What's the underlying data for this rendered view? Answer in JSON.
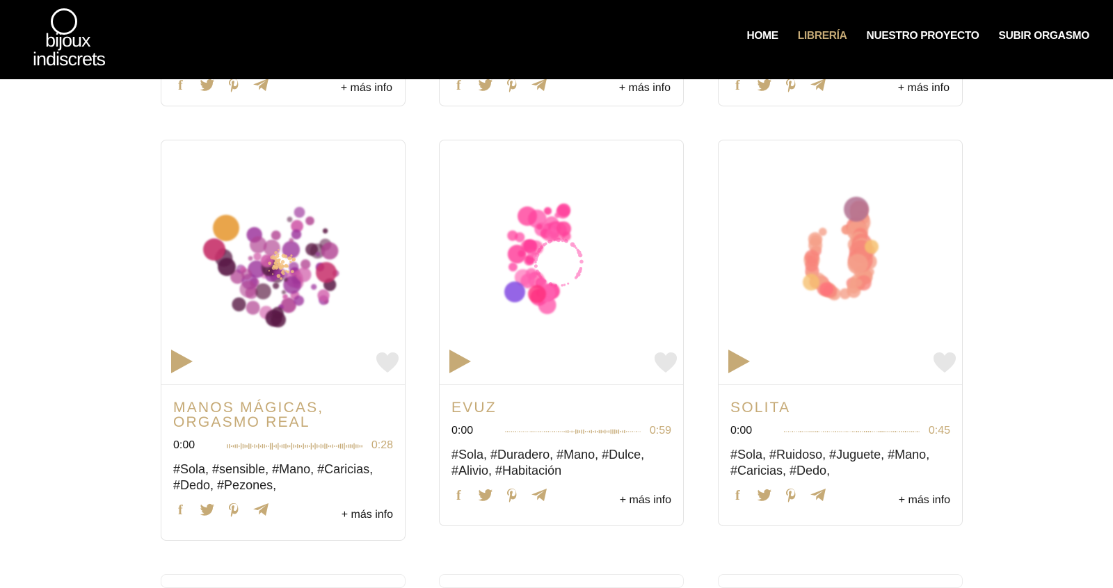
{
  "header": {
    "logo_line1": "bijoux",
    "logo_line2": "indiscrets",
    "nav": [
      {
        "label": "HOME",
        "active": false
      },
      {
        "label": "LIBRERÍA",
        "active": true
      },
      {
        "label": "NUESTRO PROYECTO",
        "active": false
      },
      {
        "label": "SUBIR ORGASMO",
        "active": false
      }
    ]
  },
  "colors": {
    "accent": "#c6aa76",
    "nav_bg": "#000000",
    "text": "#222222"
  },
  "share_icons": [
    "facebook-icon",
    "twitter-icon",
    "pinterest-icon",
    "telegram-icon"
  ],
  "partial_cards": [
    {
      "more": "+ más info"
    },
    {
      "more": "+ más info"
    },
    {
      "more": "+ más info"
    }
  ],
  "cards": [
    {
      "title": "MANOS MÁGICAS, ORGASMO REAL",
      "time_start": "0:00",
      "time_end": "0:28",
      "tags": "#Sola, #sensible, #Mano, #Caricias, #Dedo, #Pezones,",
      "more": "+ más info",
      "palette": [
        "#e8a040",
        "#c7306a",
        "#9a2f9a",
        "#5a1a45",
        "#d05aa8",
        "#b04090"
      ]
    },
    {
      "title": "EVUZ",
      "time_start": "0:00",
      "time_end": "0:59",
      "tags": "#Sola, #Duradero, #Mano, #Dulce, #Alivio, #Habitación",
      "more": "+ más info",
      "palette": [
        "#ff3f9a",
        "#ff60b0",
        "#7a3fe0",
        "#ff2d7a",
        "#ff9bd0"
      ]
    },
    {
      "title": "SOLITA",
      "time_start": "0:00",
      "time_end": "0:45",
      "tags": "#Sola, #Ruidoso, #Juguete, #Mano, #Caricias, #Dedo,",
      "more": "+ más info",
      "palette": [
        "#f7857a",
        "#f5a08a",
        "#b07090",
        "#f6c070",
        "#ff6f7a"
      ]
    }
  ]
}
